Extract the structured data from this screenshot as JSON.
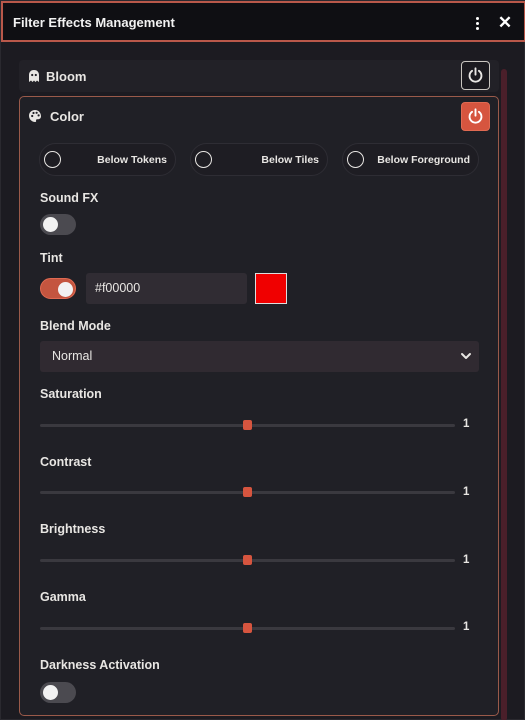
{
  "window": {
    "title": "Filter Effects Management",
    "close_label": "✕"
  },
  "panels": {
    "bloom": {
      "label": "Bloom",
      "icon": "ghost-icon",
      "enabled": false
    },
    "color": {
      "label": "Color",
      "icon": "palette-icon",
      "enabled": true,
      "placement_options": [
        {
          "label": "Below Tokens",
          "selected": false
        },
        {
          "label": "Below Tiles",
          "selected": false
        },
        {
          "label": "Below Foreground",
          "selected": false
        }
      ],
      "sound_fx": {
        "label": "Sound FX",
        "on": false
      },
      "tint": {
        "label": "Tint",
        "on": true,
        "value": "#f00000",
        "swatch_color": "#f00000"
      },
      "blend_mode": {
        "label": "Blend Mode",
        "selected": "Normal"
      },
      "sliders": [
        {
          "label": "Saturation",
          "value": "1",
          "fraction": 0.5
        },
        {
          "label": "Contrast",
          "value": "1",
          "fraction": 0.5
        },
        {
          "label": "Brightness",
          "value": "1",
          "fraction": 0.5
        },
        {
          "label": "Gamma",
          "value": "1",
          "fraction": 0.5
        }
      ],
      "darkness_activation": {
        "label": "Darkness Activation",
        "on": false
      }
    }
  },
  "colors": {
    "accent": "#d6553f",
    "title_border": "#b9584a",
    "panel_border": "#9a5a4a"
  }
}
